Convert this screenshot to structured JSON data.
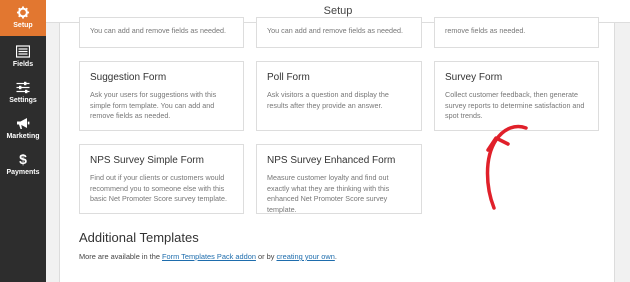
{
  "sidebar": {
    "items": [
      {
        "label": "Setup",
        "icon": "gear-icon",
        "active": true
      },
      {
        "label": "Fields",
        "icon": "list-icon",
        "active": false
      },
      {
        "label": "Settings",
        "icon": "sliders-icon",
        "active": false
      },
      {
        "label": "Marketing",
        "icon": "megaphone-icon",
        "active": false
      },
      {
        "label": "Payments",
        "icon": "dollar-icon",
        "active": false
      }
    ]
  },
  "header": {
    "title": "Setup"
  },
  "templates": {
    "top_row_desc": [
      "You can add and remove fields as needed.",
      "You can add and remove fields as needed.",
      "remove fields as needed."
    ],
    "cards": [
      {
        "title": "Suggestion Form",
        "desc": "Ask your users for suggestions with this simple form template. You can add and remove fields as needed."
      },
      {
        "title": "Poll Form",
        "desc": "Ask visitors a question and display the results after they provide an answer."
      },
      {
        "title": "Survey Form",
        "desc": "Collect customer feedback, then generate survey reports to determine satisfaction and spot trends."
      },
      {
        "title": "NPS Survey Simple Form",
        "desc": "Find out if your clients or customers would recommend you to someone else with this basic Net Promoter Score survey template."
      },
      {
        "title": "NPS Survey Enhanced Form",
        "desc": "Measure customer loyalty and find out exactly what they are thinking with this enhanced Net Promoter Score survey template."
      }
    ]
  },
  "additional": {
    "title": "Additional Templates",
    "text_before": "More are available in the ",
    "link1": "Form Templates Pack addon",
    "text_middle": " or by ",
    "link2": "creating your own",
    "text_after": "."
  },
  "colors": {
    "sidebar_bg": "#2d2d2d",
    "accent": "#e27730",
    "link": "#1e6dad",
    "annotation_arrow": "#e0202a"
  }
}
